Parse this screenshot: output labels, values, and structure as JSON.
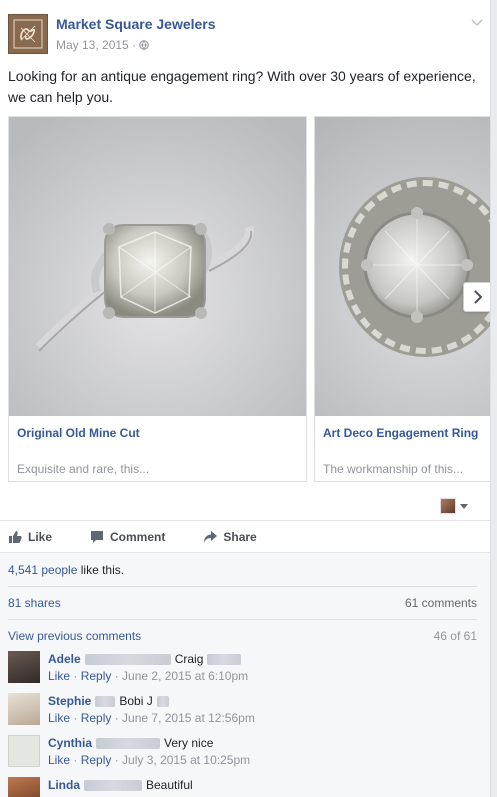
{
  "post": {
    "page_name": "Market Square Jewelers",
    "date": "May 13, 2015",
    "separator": "·",
    "text": "Looking for an antique engagement ring? With over 30 years of experience, we can help you."
  },
  "carousel": [
    {
      "title": "Original Old Mine Cut",
      "description": "Exquisite and rare, this..."
    },
    {
      "title": "Art Deco Engagement Ring",
      "description": "The workmanship of this..."
    }
  ],
  "actions": {
    "like": "Like",
    "comment": "Comment",
    "share": "Share"
  },
  "social": {
    "likes_count": "4,541 people",
    "likes_suffix": " like this.",
    "shares": "81 shares",
    "comments": "61 comments",
    "view_previous": "View previous comments",
    "comment_position": "46 of 61"
  },
  "comments": [
    {
      "author": "Adele",
      "text": "Craig",
      "like": "Like",
      "reply": "Reply",
      "date": "June 2, 2015 at 6:10pm"
    },
    {
      "author": "Stephie",
      "text": "Bobi J",
      "like": "Like",
      "reply": "Reply",
      "date": "June 7, 2015 at 12:56pm"
    },
    {
      "author": "Cynthia",
      "text": "Very nice",
      "like": "Like",
      "reply": "Reply",
      "date": "July 3, 2015 at 10:25pm"
    },
    {
      "author": "Linda",
      "text": "Beautiful",
      "like": "Like",
      "reply": "Reply",
      "date": ""
    }
  ],
  "colors": {
    "link": "#365899",
    "muted": "#90949c",
    "logo_bg": "#8a6a4f"
  },
  "icons": [
    "globe-icon",
    "chevron-down-icon",
    "like-thumb-icon",
    "comment-bubble-icon",
    "share-arrow-icon",
    "chevron-right-icon"
  ]
}
